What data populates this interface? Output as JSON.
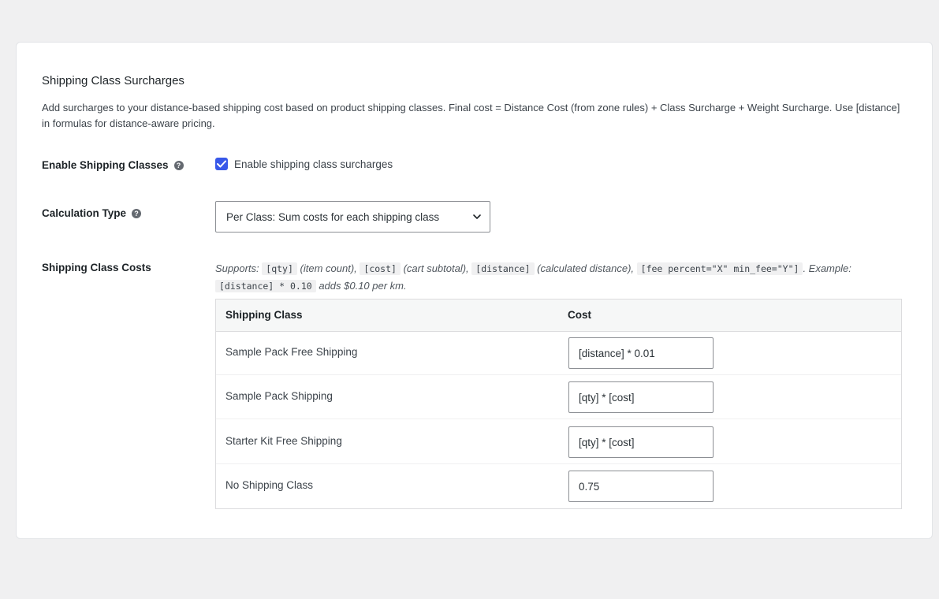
{
  "section": {
    "title": "Shipping Class Surcharges",
    "description": "Add surcharges to your distance-based shipping cost based on product shipping classes. Final cost = Distance Cost (from zone rules) + Class Surcharge + Weight Surcharge. Use [distance] in formulas for distance-aware pricing."
  },
  "enable": {
    "label": "Enable Shipping Classes",
    "checkbox_label": "Enable shipping class surcharges",
    "checked": true
  },
  "calc_type": {
    "label": "Calculation Type",
    "selected": "Per Class: Sum costs for each shipping class"
  },
  "class_costs": {
    "label": "Shipping Class Costs",
    "supports": {
      "prefix": "Supports:",
      "code_qty": "[qty]",
      "desc_qty": "(item count),",
      "code_cost": "[cost]",
      "desc_cost": "(cart subtotal),",
      "code_distance": "[distance]",
      "desc_distance": "(calculated distance),",
      "code_fee": "[fee percent=\"X\" min_fee=\"Y\"]",
      "example_label": ". Example:",
      "code_example": "[distance] * 0.10",
      "example_desc": "adds $0.10 per km."
    },
    "table": {
      "col_class": "Shipping Class",
      "col_cost": "Cost",
      "rows": [
        {
          "name": "Sample Pack Free Shipping",
          "cost": "[distance] * 0.01"
        },
        {
          "name": "Sample Pack Shipping",
          "cost": "[qty] * [cost]"
        },
        {
          "name": "Starter Kit Free Shipping",
          "cost": "[qty] * [cost]"
        },
        {
          "name": "No Shipping Class",
          "cost": "0.75"
        }
      ]
    }
  },
  "colors": {
    "accent": "#3858e9",
    "background": "#f0f0f1",
    "card": "#ffffff"
  }
}
